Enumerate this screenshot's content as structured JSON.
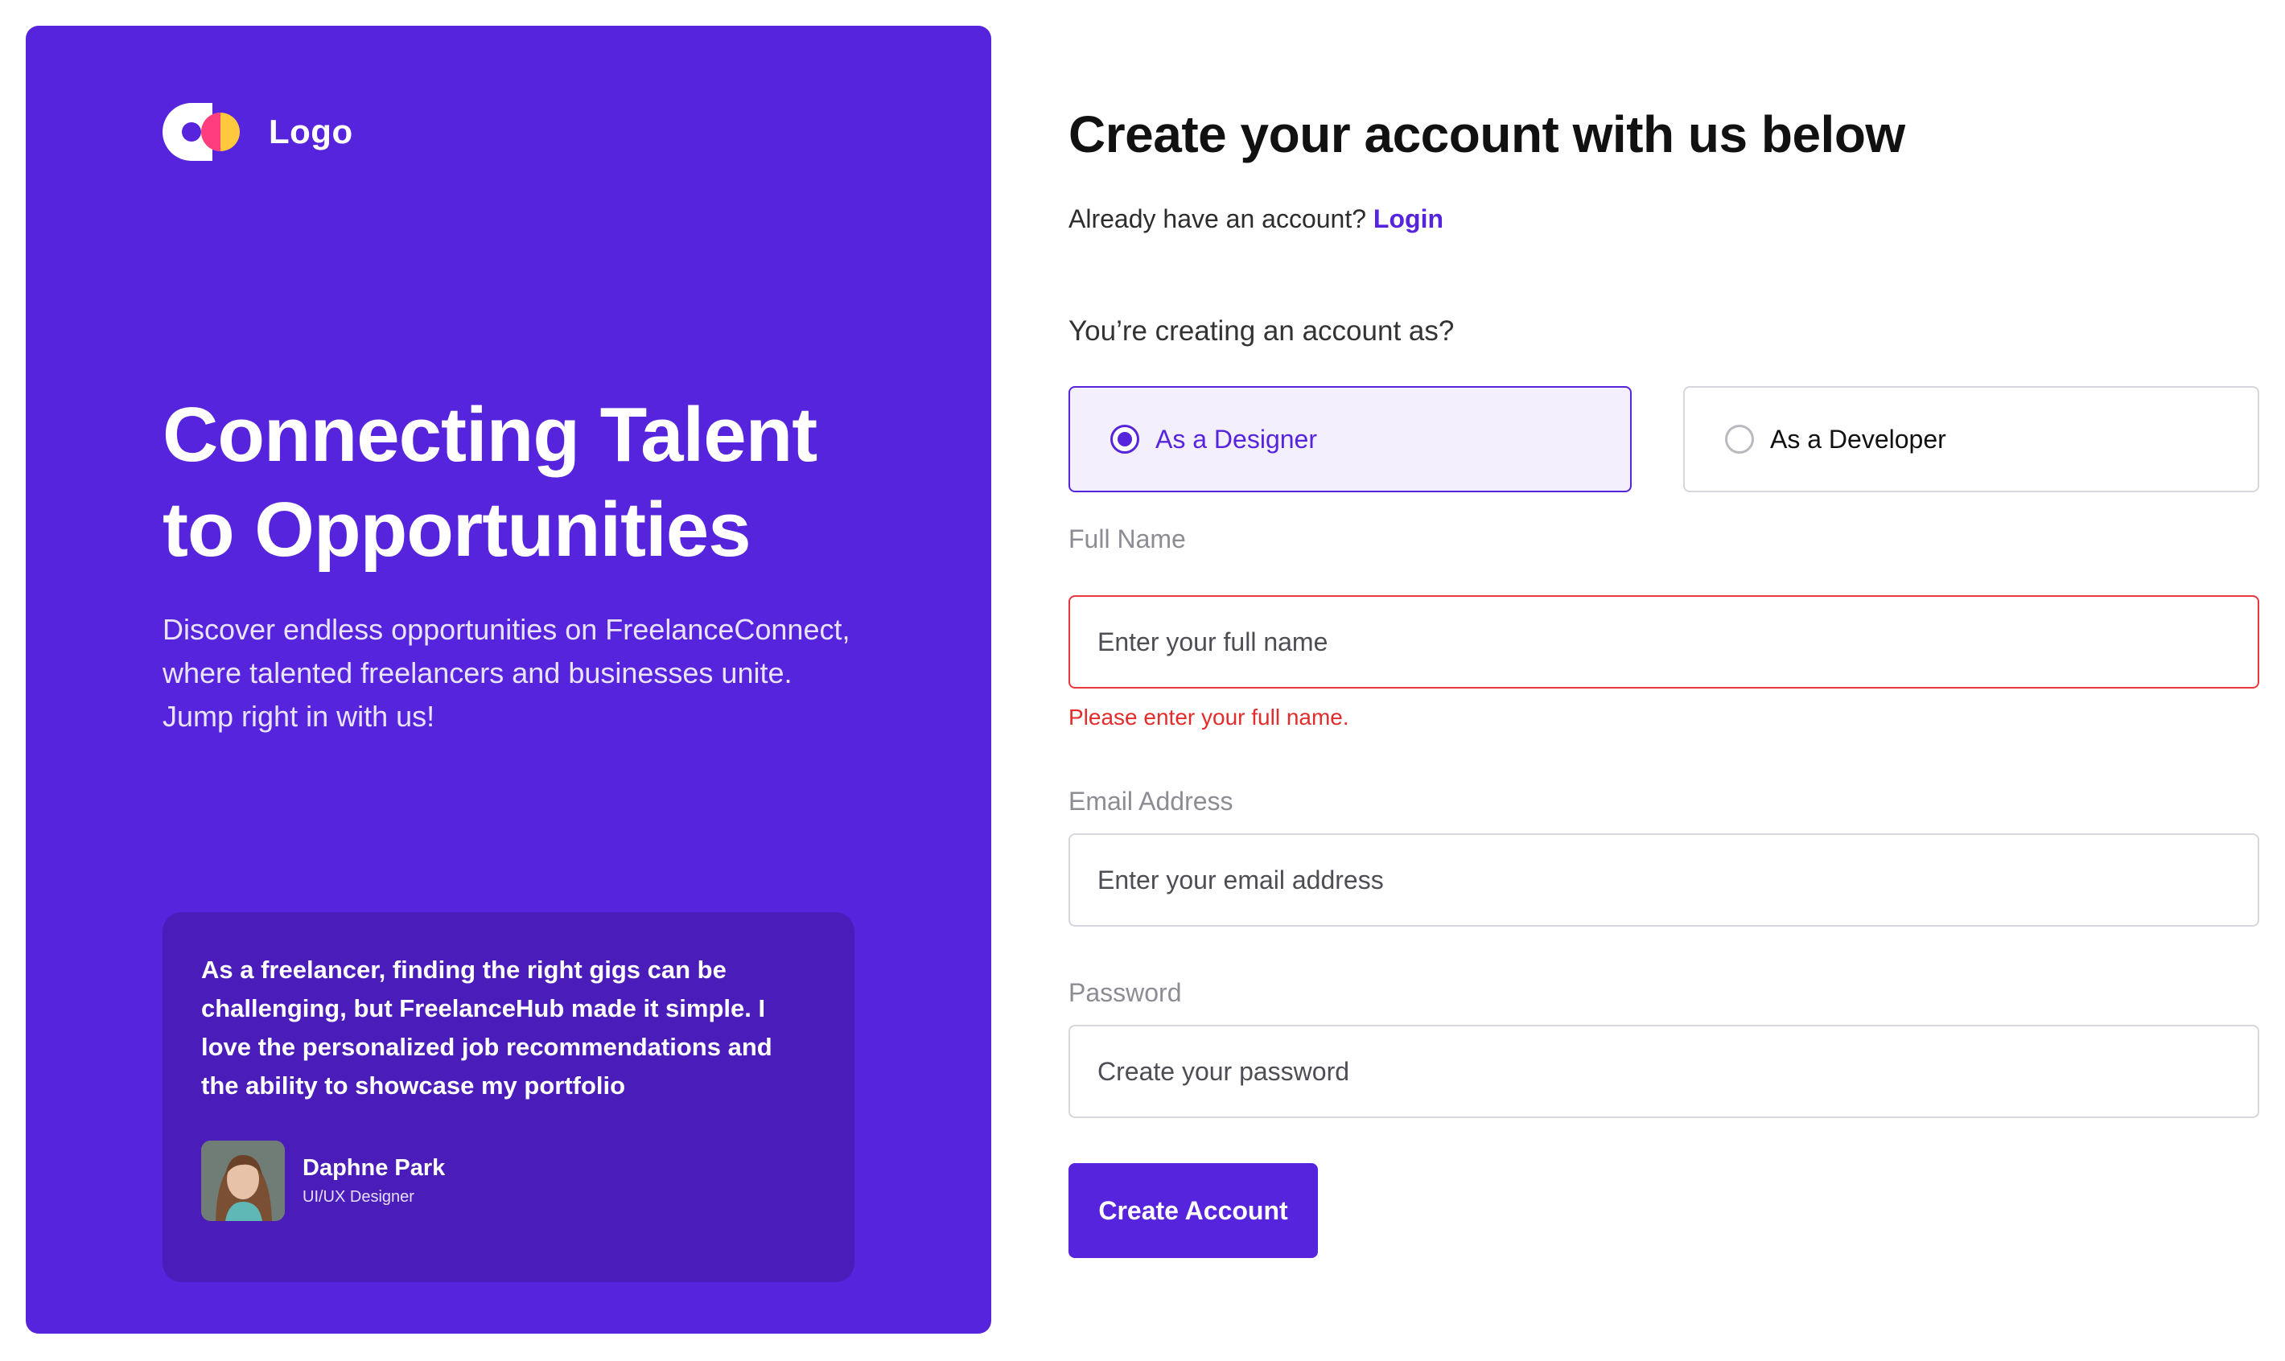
{
  "brand": {
    "logo_text": "Logo",
    "colors": {
      "primary": "#5724DD",
      "logo_pink": "#FF3D7F",
      "logo_yellow": "#FFC83D",
      "error": "#E32C2C"
    }
  },
  "hero": {
    "title_line1": "Connecting Talent",
    "title_line2": "to Opportunities",
    "subtitle_line1": "Discover endless opportunities on FreelanceConnect,",
    "subtitle_line2": "where talented freelancers and businesses unite.",
    "subtitle_line3": "Jump right in with us!"
  },
  "testimonial": {
    "quote_line1": "As a freelancer, finding the right gigs can be",
    "quote_line2": "challenging, but FreelanceHub made it simple. I",
    "quote_line3": "love the personalized job recommendations and",
    "quote_line4": "the ability to showcase my portfolio",
    "author_name": "Daphne Park",
    "author_role": "UI/UX Designer"
  },
  "form": {
    "title": "Create your account with us below",
    "login_prompt": "Already have an account?",
    "login_link": "Login",
    "role_question": "You’re creating an account as?",
    "roles": [
      {
        "label": "As a Designer",
        "selected": true
      },
      {
        "label": "As a Developer",
        "selected": false
      }
    ],
    "full_name": {
      "label": "Full Name",
      "placeholder": "Enter your full name",
      "value": "",
      "error": "Please enter your full name."
    },
    "email": {
      "label": "Email Address",
      "placeholder": "Enter your email address",
      "value": ""
    },
    "password": {
      "label": "Password",
      "placeholder": "Create your password",
      "value": ""
    },
    "submit_label": "Create Account"
  }
}
